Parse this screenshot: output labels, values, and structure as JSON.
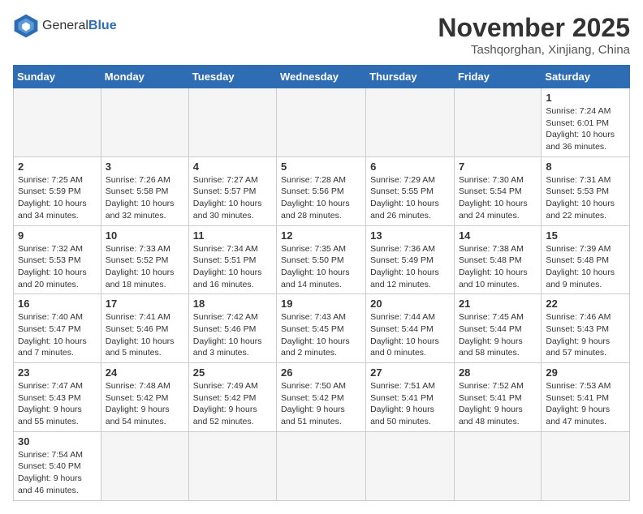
{
  "header": {
    "logo_general": "General",
    "logo_blue": "Blue",
    "month_title": "November 2025",
    "location": "Tashqorghan, Xinjiang, China"
  },
  "days_of_week": [
    "Sunday",
    "Monday",
    "Tuesday",
    "Wednesday",
    "Thursday",
    "Friday",
    "Saturday"
  ],
  "weeks": [
    [
      {
        "day": "",
        "info": ""
      },
      {
        "day": "",
        "info": ""
      },
      {
        "day": "",
        "info": ""
      },
      {
        "day": "",
        "info": ""
      },
      {
        "day": "",
        "info": ""
      },
      {
        "day": "",
        "info": ""
      },
      {
        "day": "1",
        "info": "Sunrise: 7:24 AM\nSunset: 6:01 PM\nDaylight: 10 hours and 36 minutes."
      }
    ],
    [
      {
        "day": "2",
        "info": "Sunrise: 7:25 AM\nSunset: 5:59 PM\nDaylight: 10 hours and 34 minutes."
      },
      {
        "day": "3",
        "info": "Sunrise: 7:26 AM\nSunset: 5:58 PM\nDaylight: 10 hours and 32 minutes."
      },
      {
        "day": "4",
        "info": "Sunrise: 7:27 AM\nSunset: 5:57 PM\nDaylight: 10 hours and 30 minutes."
      },
      {
        "day": "5",
        "info": "Sunrise: 7:28 AM\nSunset: 5:56 PM\nDaylight: 10 hours and 28 minutes."
      },
      {
        "day": "6",
        "info": "Sunrise: 7:29 AM\nSunset: 5:55 PM\nDaylight: 10 hours and 26 minutes."
      },
      {
        "day": "7",
        "info": "Sunrise: 7:30 AM\nSunset: 5:54 PM\nDaylight: 10 hours and 24 minutes."
      },
      {
        "day": "8",
        "info": "Sunrise: 7:31 AM\nSunset: 5:53 PM\nDaylight: 10 hours and 22 minutes."
      }
    ],
    [
      {
        "day": "9",
        "info": "Sunrise: 7:32 AM\nSunset: 5:53 PM\nDaylight: 10 hours and 20 minutes."
      },
      {
        "day": "10",
        "info": "Sunrise: 7:33 AM\nSunset: 5:52 PM\nDaylight: 10 hours and 18 minutes."
      },
      {
        "day": "11",
        "info": "Sunrise: 7:34 AM\nSunset: 5:51 PM\nDaylight: 10 hours and 16 minutes."
      },
      {
        "day": "12",
        "info": "Sunrise: 7:35 AM\nSunset: 5:50 PM\nDaylight: 10 hours and 14 minutes."
      },
      {
        "day": "13",
        "info": "Sunrise: 7:36 AM\nSunset: 5:49 PM\nDaylight: 10 hours and 12 minutes."
      },
      {
        "day": "14",
        "info": "Sunrise: 7:38 AM\nSunset: 5:48 PM\nDaylight: 10 hours and 10 minutes."
      },
      {
        "day": "15",
        "info": "Sunrise: 7:39 AM\nSunset: 5:48 PM\nDaylight: 10 hours and 9 minutes."
      }
    ],
    [
      {
        "day": "16",
        "info": "Sunrise: 7:40 AM\nSunset: 5:47 PM\nDaylight: 10 hours and 7 minutes."
      },
      {
        "day": "17",
        "info": "Sunrise: 7:41 AM\nSunset: 5:46 PM\nDaylight: 10 hours and 5 minutes."
      },
      {
        "day": "18",
        "info": "Sunrise: 7:42 AM\nSunset: 5:46 PM\nDaylight: 10 hours and 3 minutes."
      },
      {
        "day": "19",
        "info": "Sunrise: 7:43 AM\nSunset: 5:45 PM\nDaylight: 10 hours and 2 minutes."
      },
      {
        "day": "20",
        "info": "Sunrise: 7:44 AM\nSunset: 5:44 PM\nDaylight: 10 hours and 0 minutes."
      },
      {
        "day": "21",
        "info": "Sunrise: 7:45 AM\nSunset: 5:44 PM\nDaylight: 9 hours and 58 minutes."
      },
      {
        "day": "22",
        "info": "Sunrise: 7:46 AM\nSunset: 5:43 PM\nDaylight: 9 hours and 57 minutes."
      }
    ],
    [
      {
        "day": "23",
        "info": "Sunrise: 7:47 AM\nSunset: 5:43 PM\nDaylight: 9 hours and 55 minutes."
      },
      {
        "day": "24",
        "info": "Sunrise: 7:48 AM\nSunset: 5:42 PM\nDaylight: 9 hours and 54 minutes."
      },
      {
        "day": "25",
        "info": "Sunrise: 7:49 AM\nSunset: 5:42 PM\nDaylight: 9 hours and 52 minutes."
      },
      {
        "day": "26",
        "info": "Sunrise: 7:50 AM\nSunset: 5:42 PM\nDaylight: 9 hours and 51 minutes."
      },
      {
        "day": "27",
        "info": "Sunrise: 7:51 AM\nSunset: 5:41 PM\nDaylight: 9 hours and 50 minutes."
      },
      {
        "day": "28",
        "info": "Sunrise: 7:52 AM\nSunset: 5:41 PM\nDaylight: 9 hours and 48 minutes."
      },
      {
        "day": "29",
        "info": "Sunrise: 7:53 AM\nSunset: 5:41 PM\nDaylight: 9 hours and 47 minutes."
      }
    ],
    [
      {
        "day": "30",
        "info": "Sunrise: 7:54 AM\nSunset: 5:40 PM\nDaylight: 9 hours and 46 minutes."
      },
      {
        "day": "",
        "info": ""
      },
      {
        "day": "",
        "info": ""
      },
      {
        "day": "",
        "info": ""
      },
      {
        "day": "",
        "info": ""
      },
      {
        "day": "",
        "info": ""
      },
      {
        "day": "",
        "info": ""
      }
    ]
  ]
}
